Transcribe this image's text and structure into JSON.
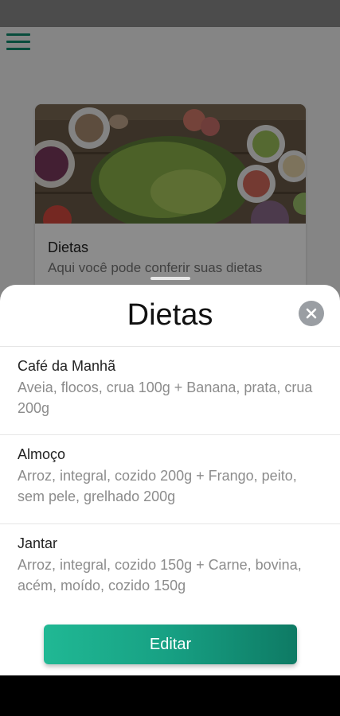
{
  "background": {
    "card": {
      "title": "Dietas",
      "description": "Aqui você pode conferir suas dietas"
    }
  },
  "sheet": {
    "title": "Dietas",
    "meals": [
      {
        "name": "Café da Manhã",
        "description": "Aveia, flocos, crua 100g + Banana, prata, crua 200g"
      },
      {
        "name": "Almoço",
        "description": "Arroz, integral, cozido 200g + Frango, peito, sem pele, grelhado 200g"
      },
      {
        "name": "Jantar",
        "description": "Arroz, integral, cozido 150g + Carne, bovina, acém, moído, cozido 150g"
      }
    ],
    "edit_label": "Editar"
  },
  "colors": {
    "accent": "#17a083",
    "accent_dark": "#0e7a64",
    "menu_icon": "#0f8a6e"
  },
  "icons": {
    "menu": "hamburger-menu-icon",
    "close": "close-icon"
  }
}
